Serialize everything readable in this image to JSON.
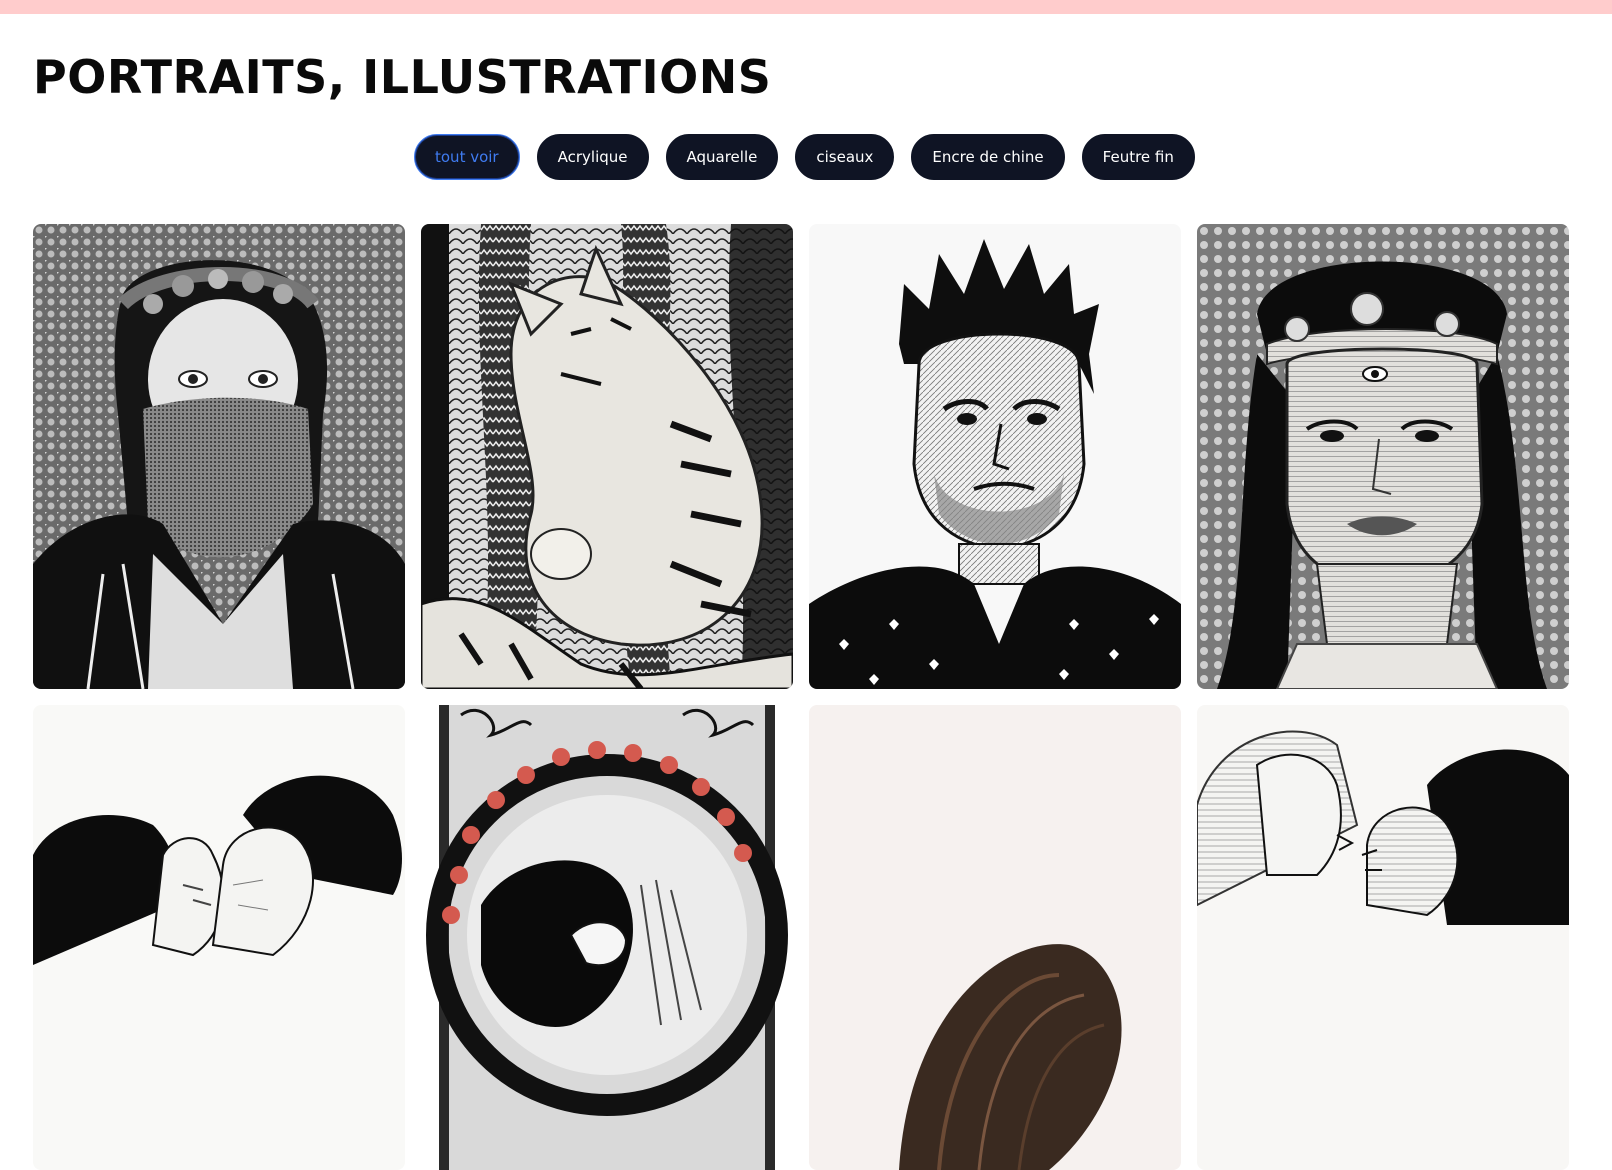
{
  "page": {
    "title": "PORTRAITS, ILLUSTRATIONS"
  },
  "filters": [
    {
      "label": "tout voir",
      "active": true
    },
    {
      "label": "Acrylique",
      "active": false
    },
    {
      "label": "Aquarelle",
      "active": false
    },
    {
      "label": "ciseaux",
      "active": false
    },
    {
      "label": "Encre de chine",
      "active": false
    },
    {
      "label": "Feutre fin",
      "active": false
    }
  ],
  "gallery": {
    "items": [
      {
        "subject": "woman-with-bandana-portrait"
      },
      {
        "subject": "sleeping-cat-illustration"
      },
      {
        "subject": "man-with-spiky-hair-portrait"
      },
      {
        "subject": "woman-with-third-eye-headband-portrait"
      },
      {
        "subject": "kissing-couple-illustration"
      },
      {
        "subject": "art-nouveau-circle-illustration"
      },
      {
        "subject": "flowing-hair-illustration"
      },
      {
        "subject": "couple-profiles-illustration"
      }
    ]
  },
  "colors": {
    "top_bar": "#ffcccc",
    "button_bg": "#0f1424",
    "active_text": "#3f7bf0"
  }
}
